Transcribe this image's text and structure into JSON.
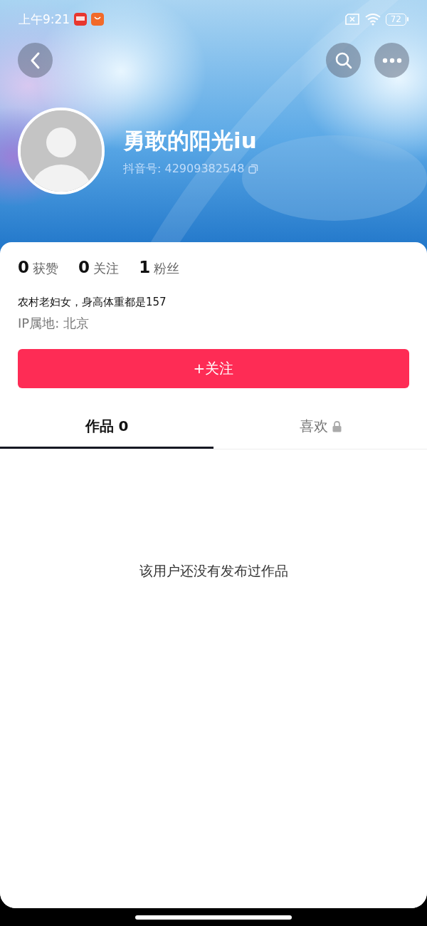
{
  "status_bar": {
    "time": "上午9:21",
    "battery": "72"
  },
  "profile": {
    "name": "勇敢的阳光iu",
    "account_id": "抖音号: 42909382548"
  },
  "stats": [
    {
      "text": "0 获赞"
    },
    {
      "text": "0 关注"
    },
    {
      "text": "1 粉丝"
    }
  ],
  "bio": "农村老妇女，身高体重都是157",
  "ip_location": "IP属地: 北京",
  "follow_button": "+关注",
  "tabs": [
    {
      "label": "作品 0",
      "selected": true,
      "locked": false
    },
    {
      "label": "喜欢",
      "selected": false,
      "locked": true
    }
  ],
  "empty_message": "该用户还没有发布过作品"
}
